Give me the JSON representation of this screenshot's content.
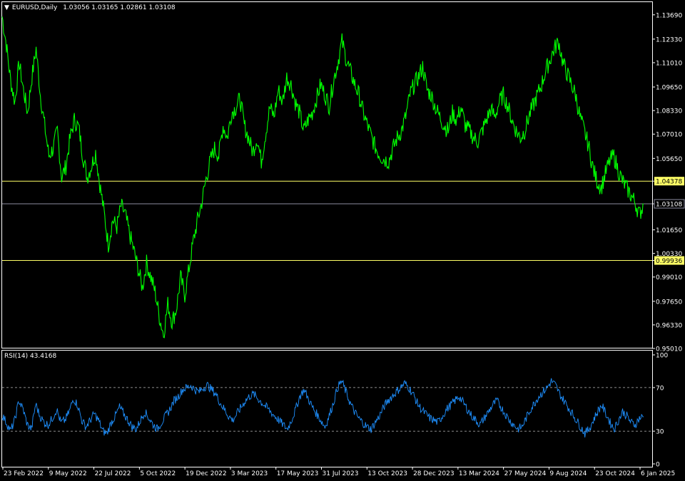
{
  "header": {
    "symbol": "EURUSD,Daily",
    "ohlc": "1.03056 1.03165 1.02861 1.03108"
  },
  "rsi_header": "RSI(14) 43.4168",
  "colors": {
    "background": "#000000",
    "price": "#00ff00",
    "rsi": "#1e90ff",
    "hline": "#ffff66",
    "current": "#8c8ca0",
    "frame": "#ffffff"
  },
  "chart_data": [
    {
      "type": "line",
      "title": "EURUSD,Daily",
      "ylim": [
        0.9505,
        1.144
      ],
      "y_ticks": [
        "1.13690",
        "1.12330",
        "1.11010",
        "1.09650",
        "1.08330",
        "1.07010",
        "1.05650",
        "1.04378",
        "1.03108",
        "1.01650",
        "1.00330",
        "0.99936",
        "0.99010",
        "0.97650",
        "0.96330",
        "0.95010"
      ],
      "y_tick_values": [
        1.1369,
        1.1233,
        1.1101,
        1.0965,
        1.0833,
        1.0701,
        1.0565,
        1.04378,
        1.03108,
        1.0165,
        1.0033,
        0.99936,
        0.9901,
        0.9765,
        0.9633,
        0.9501
      ],
      "x_ticks": [
        "23 Feb 2022",
        "9 May 2022",
        "22 Jul 2022",
        "5 Oct 2022",
        "19 Dec 2022",
        "3 Mar 2023",
        "17 May 2023",
        "31 Jul 2023",
        "13 Oct 2023",
        "28 Dec 2023",
        "13 Mar 2024",
        "27 May 2024",
        "9 Aug 2024",
        "23 Oct 2024",
        "6 Jan 2025"
      ],
      "horizontal_lines": [
        {
          "label": "1.04378",
          "value": 1.04378,
          "color": "#ffff66",
          "highlight": true
        },
        {
          "label": "1.03108",
          "value": 1.03108,
          "color": "#8c8ca0",
          "highlight": false
        },
        {
          "label": "0.99936",
          "value": 0.99936,
          "color": "#ffff66",
          "highlight": true
        }
      ],
      "series": [
        {
          "values": [
            1.136,
            1.12,
            1.1,
            1.088,
            1.11,
            1.095,
            1.082,
            1.102,
            1.118,
            1.092,
            1.075,
            1.058,
            1.062,
            1.072,
            1.046,
            1.052,
            1.068,
            1.078,
            1.074,
            1.058,
            1.046,
            1.052,
            1.06,
            1.042,
            1.026,
            1.008,
            1.022,
            1.018,
            1.03,
            1.025,
            1.014,
            1.005,
            0.995,
            0.984,
            0.998,
            0.99,
            0.982,
            0.968,
            0.958,
            0.975,
            0.965,
            0.972,
            0.99,
            0.98,
            0.995,
            1.01,
            1.022,
            1.032,
            1.045,
            1.055,
            1.062,
            1.058,
            1.075,
            1.068,
            1.082,
            1.085,
            1.09,
            1.075,
            1.068,
            1.06,
            1.068,
            1.055,
            1.07,
            1.085,
            1.08,
            1.095,
            1.088,
            1.102,
            1.098,
            1.088,
            1.082,
            1.072,
            1.078,
            1.082,
            1.09,
            1.098,
            1.092,
            1.086,
            1.1,
            1.11,
            1.122,
            1.112,
            1.105,
            1.098,
            1.092,
            1.082,
            1.075,
            1.068,
            1.062,
            1.058,
            1.056,
            1.055,
            1.062,
            1.068,
            1.072,
            1.08,
            1.092,
            1.098,
            1.102,
            1.108,
            1.095,
            1.092,
            1.085,
            1.08,
            1.075,
            1.072,
            1.082,
            1.078,
            1.085,
            1.075,
            1.072,
            1.068,
            1.066,
            1.072,
            1.078,
            1.084,
            1.08,
            1.088,
            1.092,
            1.086,
            1.078,
            1.072,
            1.068,
            1.072,
            1.08,
            1.086,
            1.092,
            1.098,
            1.106,
            1.112,
            1.118,
            1.122,
            1.11,
            1.104,
            1.098,
            1.092,
            1.08,
            1.072,
            1.064,
            1.052,
            1.044,
            1.04,
            1.048,
            1.055,
            1.058,
            1.05,
            1.044,
            1.04,
            1.036,
            1.032,
            1.025,
            1.031
          ]
        }
      ]
    },
    {
      "type": "line",
      "title": "RSI(14) 43.4168",
      "ylim": [
        0,
        100
      ],
      "y_ticks": [
        "100",
        "70",
        "30",
        "0"
      ],
      "y_tick_values": [
        100,
        70,
        30,
        0
      ],
      "levels": [
        70,
        30
      ],
      "series": [
        {
          "values": [
            45,
            38,
            30,
            40,
            58,
            50,
            36,
            32,
            55,
            44,
            38,
            36,
            42,
            50,
            38,
            40,
            48,
            60,
            54,
            40,
            34,
            40,
            46,
            40,
            30,
            28,
            38,
            44,
            52,
            46,
            40,
            34,
            32,
            40,
            48,
            42,
            36,
            32,
            38,
            44,
            50,
            58,
            62,
            68,
            70,
            72,
            68,
            66,
            70,
            72,
            68,
            64,
            56,
            50,
            44,
            40,
            46,
            52,
            58,
            62,
            64,
            60,
            56,
            52,
            48,
            44,
            40,
            36,
            32,
            40,
            50,
            62,
            68,
            60,
            52,
            46,
            40,
            34,
            44,
            56,
            70,
            76,
            66,
            56,
            48,
            42,
            38,
            34,
            32,
            38,
            44,
            52,
            58,
            62,
            66,
            70,
            74,
            70,
            64,
            56,
            50,
            46,
            42,
            40,
            38,
            44,
            50,
            54,
            58,
            62,
            56,
            50,
            44,
            40,
            36,
            42,
            48,
            54,
            58,
            52,
            46,
            40,
            36,
            32,
            34,
            42,
            50,
            56,
            62,
            66,
            70,
            76,
            72,
            64,
            58,
            52,
            46,
            40,
            34,
            28,
            32,
            40,
            48,
            54,
            46,
            38,
            32,
            40,
            48,
            44,
            38,
            36,
            42,
            43.4
          ]
        }
      ]
    }
  ]
}
